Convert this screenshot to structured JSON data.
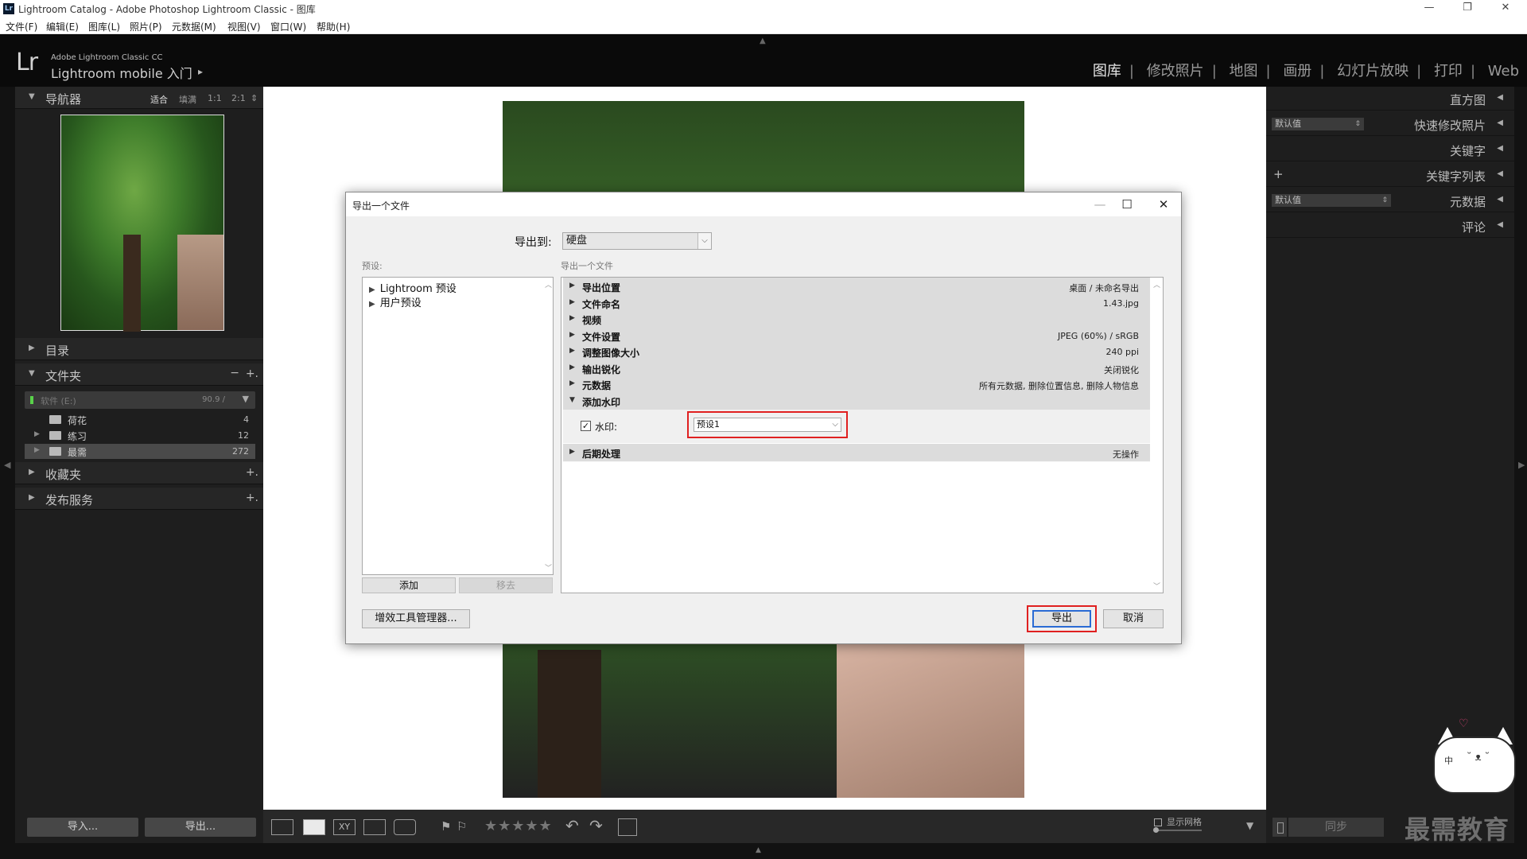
{
  "window": {
    "title": "Lightroom Catalog - Adobe Photoshop Lightroom Classic - 图库",
    "app_icon": "Lr",
    "controls": {
      "minimize": "—",
      "restore": "❐",
      "close": "✕"
    }
  },
  "menu": [
    "文件(F)",
    "编辑(E)",
    "图库(L)",
    "照片(P)",
    "元数据(M)",
    "视图(V)",
    "窗口(W)",
    "帮助(H)"
  ],
  "identity": {
    "logo": "Lr",
    "line1": "Adobe Lightroom Classic CC",
    "line2": "Lightroom mobile 入门",
    "arrow": "▸"
  },
  "modules": [
    "图库",
    "修改照片",
    "地图",
    "画册",
    "幻灯片放映",
    "打印",
    "Web"
  ],
  "active_module": "图库",
  "module_separator": "|",
  "left_panel": {
    "navigator": {
      "title": "导航器",
      "options": [
        "适合",
        "填满",
        "1:1",
        "2:1"
      ],
      "spin": "⇕"
    },
    "catalog": {
      "title": "目录"
    },
    "folders": {
      "title": "文件夹",
      "minus": "−",
      "plus": "+.",
      "drive": {
        "label": "软件 (E:)",
        "size": "90.9 /",
        "dropdown": "▼"
      },
      "items": [
        {
          "name": "荷花",
          "count": "4",
          "expandable": false
        },
        {
          "name": "练习",
          "count": "12",
          "expandable": true
        },
        {
          "name": "最需",
          "count": "272",
          "expandable": true,
          "selected": true
        }
      ]
    },
    "collections": {
      "title": "收藏夹",
      "plus": "+."
    },
    "publish": {
      "title": "发布服务",
      "plus": "+."
    },
    "import_label": "导入...",
    "export_label": "导出..."
  },
  "right_panel": {
    "histogram": "直方图",
    "quick_develop": {
      "title": "快速修改照片",
      "preset": "默认值"
    },
    "keywording": "关键字",
    "keyword_list": {
      "title": "关键字列表",
      "plus": "+"
    },
    "metadata": {
      "title": "元数据",
      "preset": "默认值"
    },
    "comments": "评论",
    "collapse": "◀",
    "sync_label": "同步"
  },
  "toolbar": {
    "stars": "★★★★★",
    "xy": "XY",
    "show_grid": "显示网格",
    "dropdown": "▼"
  },
  "dialog": {
    "title": "导出一个文件",
    "export_to_label": "导出到:",
    "export_to_value": "硬盘",
    "presets_label": "预设:",
    "section_label": "导出一个文件",
    "presets": [
      "Lightroom 预设",
      "用户预设"
    ],
    "add_label": "添加",
    "remove_label": "移去",
    "sections": [
      {
        "name": "导出位置",
        "summary": "桌面 / 未命名导出",
        "open": false
      },
      {
        "name": "文件命名",
        "summary": "1.43.jpg",
        "open": false
      },
      {
        "name": "视频",
        "summary": "",
        "open": false
      },
      {
        "name": "文件设置",
        "summary": "JPEG (60%) / sRGB",
        "open": false
      },
      {
        "name": "调整图像大小",
        "summary": "240 ppi",
        "open": false
      },
      {
        "name": "输出锐化",
        "summary": "关闭锐化",
        "open": false
      },
      {
        "name": "元数据",
        "summary": "所有元数据, 删除位置信息, 删除人物信息",
        "open": false
      },
      {
        "name": "添加水印",
        "summary": "",
        "open": true
      }
    ],
    "post_processing": {
      "name": "后期处理",
      "summary": "无操作"
    },
    "watermark": {
      "checkbox_label": "水印:",
      "checked": true,
      "value": "预设1"
    },
    "plugin_manager_label": "增效工具管理器...",
    "export_label": "导出",
    "cancel_label": "取消",
    "highlight_color": "#e02020"
  },
  "branding_watermark": {
    "text": "最需教育",
    "mascot_char": "中",
    "mascot_face": "˘ ᴥ ˘",
    "heart": "♡"
  }
}
